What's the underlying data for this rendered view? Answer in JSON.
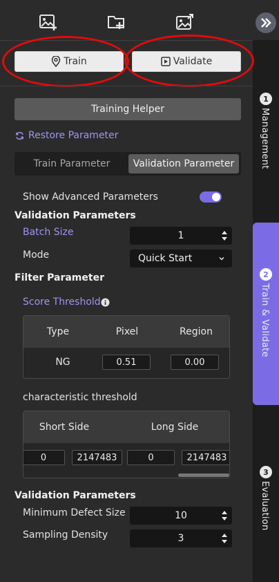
{
  "toolbar": {
    "icons": [
      "add-image-icon",
      "add-folder-icon",
      "export-image-icon"
    ],
    "collapse_icon": "double-chevron-right-icon"
  },
  "actions": {
    "train_label": "Train",
    "validate_label": "Validate"
  },
  "helper_label": "Training Helper",
  "restore_label": "Restore Parameter",
  "param_tabs": {
    "train": "Train Parameter",
    "validation": "Validation Parameter",
    "active": "validation"
  },
  "advanced": {
    "label": "Show Advanced Parameters",
    "enabled": true
  },
  "validation_params": {
    "title": "Validation Parameters",
    "batch_size": {
      "label": "Batch Size",
      "value": "1"
    },
    "mode": {
      "label": "Mode",
      "value": "Quick Start"
    }
  },
  "filter": {
    "title": "Filter Parameter",
    "score_threshold_label": "Score Threshold",
    "columns": [
      "Type",
      "Pixel",
      "Region"
    ],
    "row": {
      "type": "NG",
      "pixel": "0.51",
      "region": "0.00"
    }
  },
  "characteristic": {
    "title": "characteristic threshold",
    "columns": [
      "Short Side",
      "Long Side"
    ],
    "values": [
      "0",
      "2147483",
      "0",
      "2147483"
    ]
  },
  "validation_params_2": {
    "title": "Validation Parameters",
    "min_defect": {
      "label": "Minimum Defect Size",
      "value": "10"
    },
    "sampling": {
      "label": "Sampling Density",
      "value": "3"
    }
  },
  "rail": [
    {
      "num": "1",
      "label": "Management",
      "active": false
    },
    {
      "num": "2",
      "label": "Train & Validate",
      "active": true
    },
    {
      "num": "3",
      "label": "Evaluation",
      "active": false
    }
  ],
  "colors": {
    "accent": "#7b6ce6",
    "accent_text": "#9d95f2",
    "annotation": "#e20b0b"
  }
}
